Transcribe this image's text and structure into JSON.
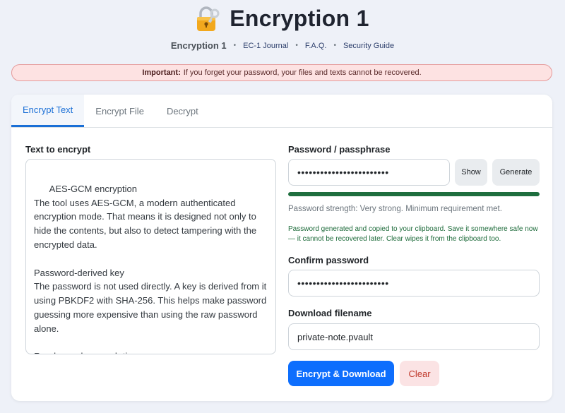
{
  "app": {
    "title": "Encryption 1",
    "icon": "locked-padlock-with-key-icon"
  },
  "nav": {
    "brand": "Encryption 1",
    "links": [
      "EC-1 Journal",
      "F.A.Q.",
      "Security Guide"
    ],
    "separator": "•"
  },
  "alert": {
    "strong": "Important:",
    "text": "If you forget your password, your files and texts cannot be recovered."
  },
  "tabs": [
    "Encrypt Text",
    "Encrypt File",
    "Decrypt"
  ],
  "active_tab": "Encrypt Text",
  "text_panel": {
    "label": "Text to encrypt",
    "value": "AES-GCM encryption\nThe tool uses AES-GCM, a modern authenticated encryption mode. That means it is designed not only to hide the contents, but also to detect tampering with the encrypted data.\n\nPassword-derived key\nThe password is not used directly. A key is derived from it using PBKDF2 with SHA-256. This helps make password guessing more expensive than using the raw password alone.\n\nRandom values each time\nThe tool generates a fresh salt and IV for every"
  },
  "password": {
    "label": "Password / passphrase",
    "masked_value": "••••••••••••••••••••••••",
    "show_label": "Show",
    "generate_label": "Generate",
    "strength_fraction": 1.0,
    "strength_color": "#1e6e3e",
    "strength_text": "Password strength: Very strong. Minimum requirement met.",
    "generated_note": "Password generated and copied to your clipboard. Save it somewhere safe now — it cannot be recovered later. Clear wipes it from the clipboard too."
  },
  "confirm": {
    "label": "Confirm password",
    "masked_value": "••••••••••••••••••••••••"
  },
  "filename": {
    "label": "Download filename",
    "value": "private-note.pvault"
  },
  "actions": {
    "primary_label": "Encrypt & Download",
    "clear_label": "Clear"
  },
  "colors": {
    "accent": "#0d6efd",
    "alert_bg": "#fde2e2",
    "success": "#1d6b3a"
  }
}
